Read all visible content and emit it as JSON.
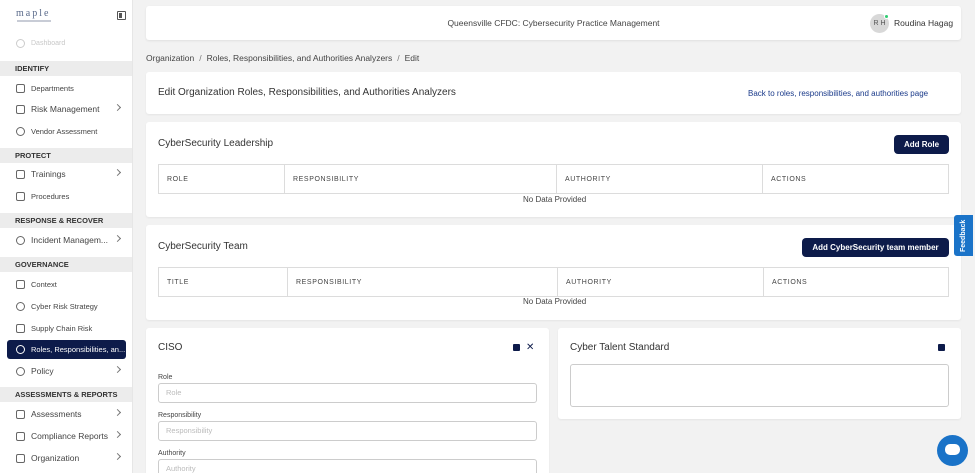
{
  "sidebar": {
    "logo": "maple",
    "dashboard": "Dashboard",
    "sections": {
      "identify": "IDENTIFY",
      "protect": "PROTECT",
      "response": "RESPONSE & RECOVER",
      "governance": "GOVERNANCE",
      "assessments": "ASSESSMENTS & REPORTS"
    },
    "items": {
      "departments": "Departments",
      "risk_management": "Risk Management",
      "vendor_assessment": "Vendor Assessment",
      "trainings": "Trainings",
      "procedures": "Procedures",
      "incident_management": "Incident Managem...",
      "context": "Context",
      "cyber_risk_strategy": "Cyber Risk Strategy",
      "supply_chain_risk": "Supply Chain Risk",
      "roles": "Roles, Responsibilities, an...",
      "policy": "Policy",
      "assessments": "Assessments",
      "compliance_reports": "Compliance Reports",
      "organization": "Organization"
    }
  },
  "topbar": {
    "org_title": "Queensville CFDC: Cybersecurity Practice Management",
    "avatar_initials": "R H",
    "user_name": "Roudina Hagag"
  },
  "breadcrumb": {
    "items": [
      "Organization",
      "Roles, Responsibilities, and Authorities Analyzers",
      "Edit"
    ],
    "separator": "/"
  },
  "header_card": {
    "title": "Edit Organization Roles, Responsibilities, and Authorities Analyzers",
    "back_link": "Back to roles, responsibilities, and authorities page"
  },
  "leadership": {
    "title": "CyberSecurity Leadership",
    "add_button": "Add Role",
    "columns": [
      "ROLE",
      "RESPONSIBILITY",
      "AUTHORITY",
      "ACTIONS"
    ],
    "empty": "No Data Provided"
  },
  "team": {
    "title": "CyberSecurity Team",
    "add_button": "Add CyberSecurity team member",
    "columns": [
      "TITLE",
      "RESPONSIBILITY",
      "AUTHORITY",
      "ACTIONS"
    ],
    "empty": "No Data Provided"
  },
  "ciso": {
    "title": "CISO",
    "role_label": "Role",
    "role_placeholder": "Role",
    "responsibility_label": "Responsibility",
    "responsibility_placeholder": "Responsibility",
    "authority_label": "Authority",
    "authority_placeholder": "Authority",
    "close_glyph": "✕"
  },
  "talent": {
    "title": "Cyber Talent Standard"
  },
  "feedback": "Feedback",
  "colors": {
    "primary": "#0d1b4a",
    "accent": "#1a73c8",
    "online": "#2ecc71"
  }
}
